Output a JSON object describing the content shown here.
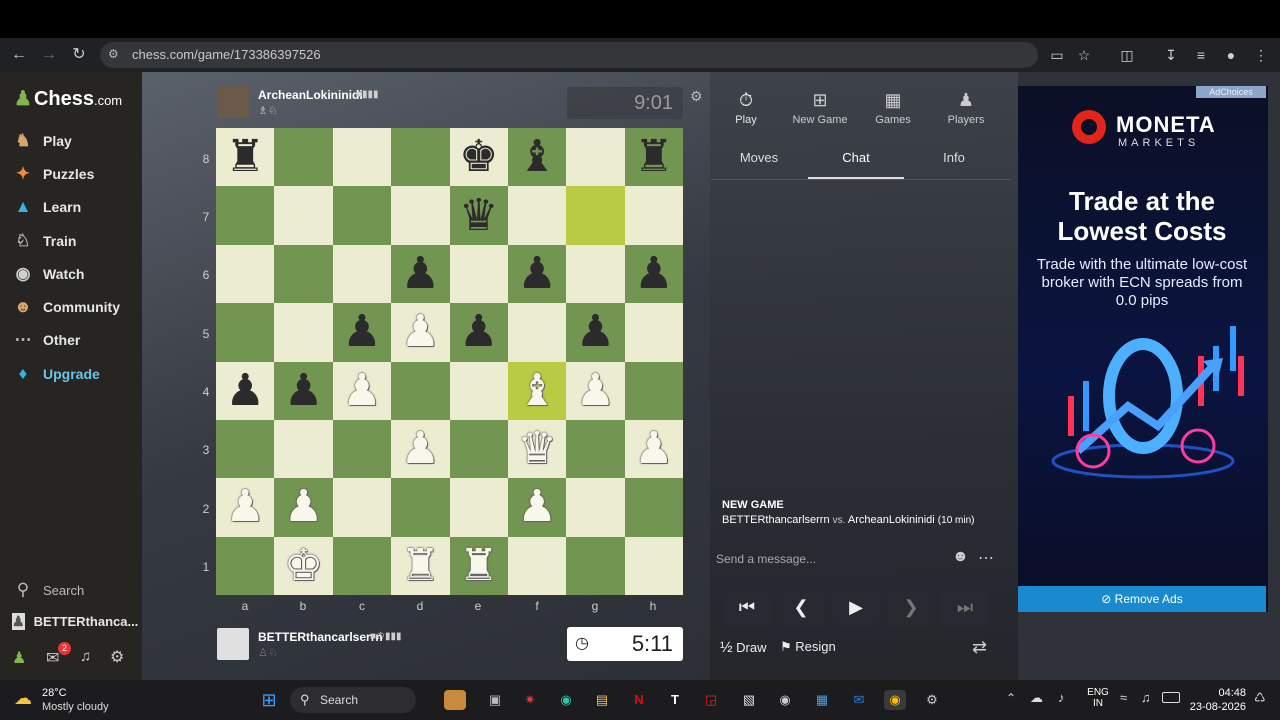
{
  "browser": {
    "url": "chess.com/game/173386397526",
    "toolbar_icons": [
      "back-icon",
      "forward-icon",
      "reload-icon",
      "site-info-icon",
      "install-icon",
      "bookmark-star-icon",
      "extensions-icon",
      "download-icon",
      "reading-list-icon",
      "profile-icon",
      "menu-icon"
    ]
  },
  "sidebar": {
    "logo": "Chess",
    "logo_suffix": ".com",
    "items": [
      {
        "label": "Play",
        "icon": "play-icon"
      },
      {
        "label": "Puzzles",
        "icon": "puzzle-icon"
      },
      {
        "label": "Learn",
        "icon": "learn-icon"
      },
      {
        "label": "Train",
        "icon": "train-icon"
      },
      {
        "label": "Watch",
        "icon": "watch-icon"
      },
      {
        "label": "Community",
        "icon": "community-icon"
      },
      {
        "label": "Other",
        "icon": "more-icon"
      },
      {
        "label": "Upgrade",
        "icon": "diamond-icon"
      }
    ],
    "search_label": "Search",
    "user_label": "BETTERthanca...",
    "notification_count": "2"
  },
  "opponent": {
    "name": "ArcheanLokininidi",
    "clock": "9:01"
  },
  "player": {
    "name": "BETTERthancarlserrn",
    "clock": "5:11"
  },
  "board": {
    "ranks": [
      "8",
      "7",
      "6",
      "5",
      "4",
      "3",
      "2",
      "1"
    ],
    "files": [
      "a",
      "b",
      "c",
      "d",
      "e",
      "f",
      "g",
      "h"
    ],
    "rows": [
      [
        "br",
        "",
        "",
        "",
        "bk",
        "bb",
        "",
        "br"
      ],
      [
        "",
        "",
        "",
        "",
        "bq",
        "",
        "",
        ""
      ],
      [
        "",
        "",
        "",
        "bp",
        "",
        "bp",
        "",
        "bp"
      ],
      [
        "",
        "",
        "bp",
        "wp",
        "bp",
        "",
        "bp",
        ""
      ],
      [
        "bp",
        "bp",
        "wp",
        "",
        "",
        "wb",
        "wp",
        ""
      ],
      [
        "",
        "",
        "",
        "wp",
        "",
        "wq",
        "",
        "wp"
      ],
      [
        "wp",
        "wp",
        "",
        "",
        "",
        "wp",
        "",
        ""
      ],
      [
        "",
        "wk",
        "",
        "wr",
        "wr",
        "",
        "",
        ""
      ]
    ],
    "highlight": [
      "g7",
      "f4"
    ]
  },
  "panel": {
    "tabs": [
      {
        "label": "Play",
        "icon": "stopwatch-icon"
      },
      {
        "label": "New Game",
        "icon": "plus-icon"
      },
      {
        "label": "Games",
        "icon": "board-icon"
      },
      {
        "label": "Players",
        "icon": "players-icon"
      }
    ],
    "subtabs": [
      "Moves",
      "Chat",
      "Info"
    ],
    "new_game_title": "NEW GAME",
    "new_game_white": "BETTERthancarlserrn",
    "new_game_vs": "vs.",
    "new_game_black": "ArcheanLokininidi",
    "new_game_time": "(10 min)",
    "message_placeholder": "Send a message...",
    "draw_label": "Draw",
    "draw_prefix": "½",
    "resign_label": "Resign"
  },
  "ad": {
    "adchoices": "AdChoices",
    "brand": "MONETA",
    "brand_sub": "MARKETS",
    "headline": "Trade at the Lowest Costs",
    "body": "Trade with the ultimate low-cost broker with ECN spreads from 0.0 pips",
    "remove_label": "Remove Ads"
  },
  "taskbar": {
    "weather_temp": "28°C",
    "weather_desc": "Mostly cloudy",
    "search_label": "Search",
    "lang": "ENG",
    "region": "IN",
    "time": "04:48",
    "date": "23-08-2026"
  }
}
